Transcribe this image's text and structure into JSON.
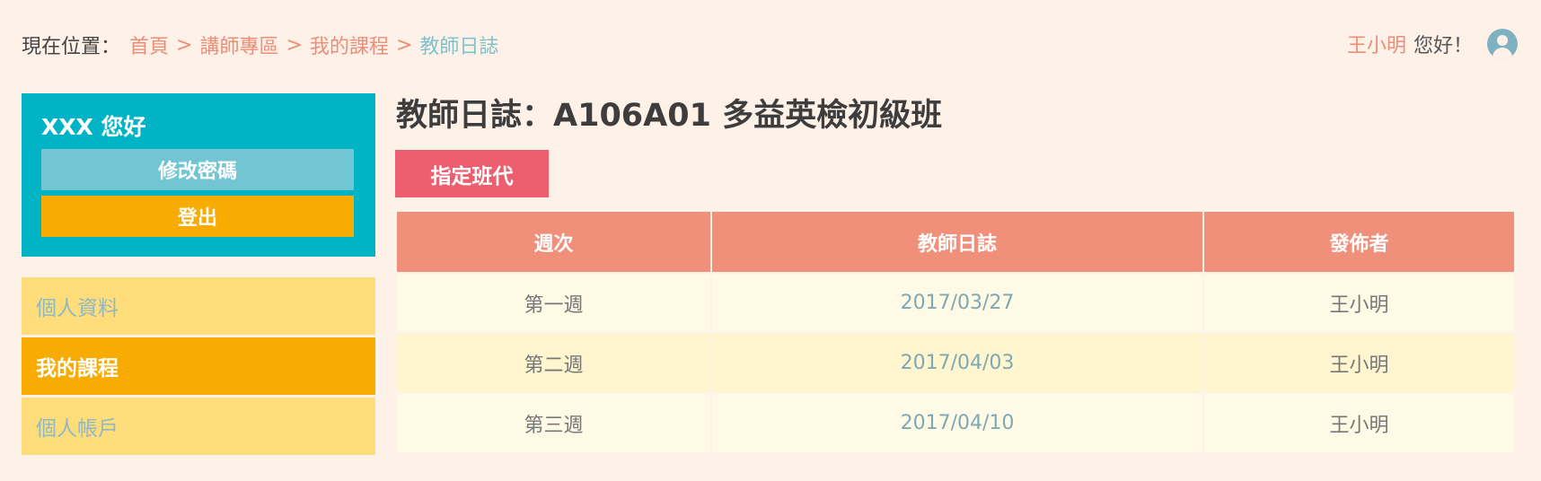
{
  "breadcrumb": {
    "prefix": "現在位置：",
    "items": [
      "首頁",
      "講師專區",
      "我的課程",
      "教師日誌"
    ],
    "separator": ">"
  },
  "header": {
    "user_name": "王小明",
    "greeting_suffix": "您好！",
    "avatar_icon": "user-avatar-icon"
  },
  "sidebar": {
    "welcome": "XXX 您好",
    "change_password_label": "修改密碼",
    "logout_label": "登出",
    "menu": [
      {
        "label": "個人資料",
        "active": false
      },
      {
        "label": "我的課程",
        "active": true
      },
      {
        "label": "個人帳戶",
        "active": false
      }
    ]
  },
  "main": {
    "title": "教師日誌：A106A01 多益英檢初級班",
    "assign_button_label": "指定班代",
    "table": {
      "headers": [
        "週次",
        "教師日誌",
        "發佈者"
      ],
      "rows": [
        {
          "week": "第一週",
          "date": "2017/03/27",
          "publisher": "王小明"
        },
        {
          "week": "第二週",
          "date": "2017/04/03",
          "publisher": "王小明"
        },
        {
          "week": "第三週",
          "date": "2017/04/10",
          "publisher": "王小明"
        }
      ]
    }
  },
  "colors": {
    "background": "#fef1e8",
    "accent_teal": "#00b3c5",
    "accent_orange": "#f8ab00",
    "accent_coral": "#f0907b",
    "accent_red": "#ed5f6e"
  }
}
